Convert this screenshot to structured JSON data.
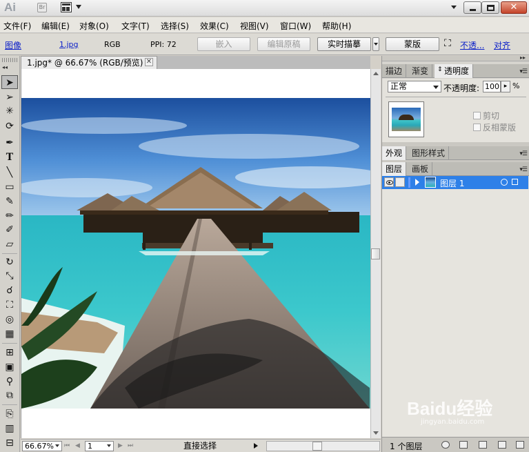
{
  "titlebar": {
    "logo": "Ai",
    "bridge_label": "Br"
  },
  "menu": [
    "文件(F)",
    "编辑(E)",
    "对象(O)",
    "文字(T)",
    "选择(S)",
    "效果(C)",
    "视图(V)",
    "窗口(W)",
    "帮助(H)"
  ],
  "control": {
    "object_type": "图像",
    "filename": "1.jpg",
    "color_mode": "RGB",
    "ppi": "PPI: 72",
    "embed_label": "嵌入",
    "edit_original_label": "编辑原稿",
    "live_trace_label": "实时描摹",
    "mask_label": "蒙版",
    "opacity_link": "不透...",
    "align_link": "对齐"
  },
  "document": {
    "tab_title": "1.jpg* @ 66.67% (RGB/预览)"
  },
  "status": {
    "zoom": "66.67%",
    "artboard": "1",
    "tool": "直接选择"
  },
  "panels": {
    "transparency_tabs": [
      "描边",
      "渐变",
      "透明度"
    ],
    "blend_mode": "正常",
    "opacity_label": "不透明度:",
    "opacity_value": "100",
    "opacity_unit": "%",
    "clip_label": "剪切",
    "invert_mask_label": "反相蒙版",
    "appearance_tabs": [
      "外观",
      "图形样式"
    ],
    "layers_tabs": [
      "图层",
      "画板"
    ],
    "layer_name": "图层 1",
    "layer_count": "1 个图层"
  },
  "watermark": {
    "brand": "Baidu经验",
    "url": "jingyan.baidu.com"
  },
  "colors": {
    "selection_blue": "#2e80e8",
    "link_blue": "#0a1ec8"
  }
}
